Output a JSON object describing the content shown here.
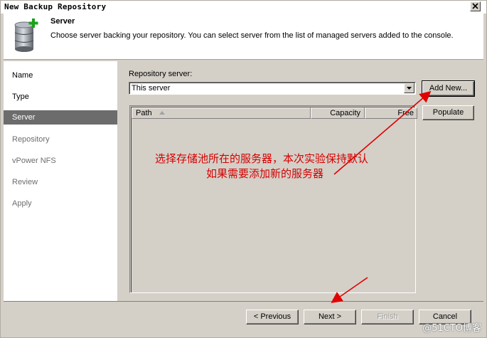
{
  "window": {
    "title": "New Backup Repository"
  },
  "header": {
    "title": "Server",
    "description": "Choose server backing your repository. You can select server from the list of managed servers added to the console.",
    "icon": "database-add-icon"
  },
  "nav": {
    "items": [
      {
        "label": "Name",
        "state": "done"
      },
      {
        "label": "Type",
        "state": "done"
      },
      {
        "label": "Server",
        "state": "active"
      },
      {
        "label": "Repository",
        "state": "disabled"
      },
      {
        "label": "vPower NFS",
        "state": "disabled"
      },
      {
        "label": "Review",
        "state": "disabled"
      },
      {
        "label": "Apply",
        "state": "disabled"
      }
    ]
  },
  "main": {
    "repo_server_label": "Repository server:",
    "repo_server_value": "This server",
    "add_new_label": "Add New...",
    "populate_label": "Populate",
    "columns": {
      "path": "Path",
      "capacity": "Capacity",
      "free": "Free"
    }
  },
  "footer": {
    "previous_label": "< Previous",
    "next_label": "Next >",
    "finish_label": "Finish",
    "cancel_label": "Cancel"
  },
  "annotations": {
    "line1": "选择存储池所在的服务器，本次实验保持默认",
    "line2": "如果需要添加新的服务器"
  },
  "watermark": "@51CTO博客",
  "colors": {
    "annotation": "#d40000",
    "active_nav": "#6c6c6c"
  }
}
